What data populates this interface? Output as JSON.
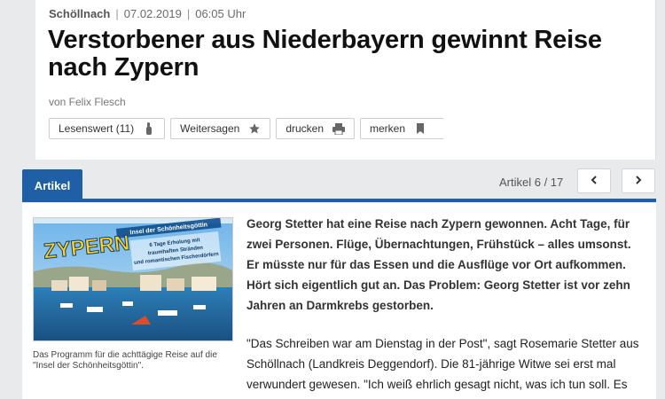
{
  "meta": {
    "location": "Schöllnach",
    "date": "07.02.2019",
    "time": "06:05 Uhr",
    "separator": "|"
  },
  "headline": "Verstorbener aus Niederbayern gewinnt Reise nach Zypern",
  "author": "von Felix Flesch",
  "actions": {
    "lesenswert": "Lesenswert (11)",
    "weitersagen": "Weitersagen",
    "drucken": "drucken",
    "merken": "merken"
  },
  "tabs": {
    "artikel": "Artikel",
    "counter": "Artikel 6 / 17"
  },
  "nav": {
    "prev_icon": "chevron-left-icon",
    "next_icon": "chevron-right-icon"
  },
  "figure": {
    "brochure_title": "ZYPERN",
    "brochure_subtitle": "Insel der Schönheitsgöttin",
    "brochure_line1": "6 Tage Erholung mit",
    "brochure_line2": "traumhaften Stränden",
    "brochure_line3": "und romantischen Fischerdörfern",
    "caption": "Das Programm für die achttägige Reise auf die \"Insel der Schönheitsgöttin\"."
  },
  "article": {
    "lead": "Georg Stetter hat eine Reise nach Zypern gewonnen. Acht Tage, für zwei Personen. Flüge, Übernachtungen, Frühstück – alles umsonst. Er müsste nur für das Essen und die Ausflüge vor Ort aufkommen. Hört sich eigentlich gut an. Das Problem: Georg Stetter ist vor zehn Jahren an Darmkrebs gestorben.",
    "para2": "\"Das Schreiben war am Dienstag in der Post\", sagt Rosemarie Stetter aus Schöllnach (Landkreis Deggendorf). Die 81-jährige Witwe sei erst mal verwundert gewesen. \"Ich weiß ehrlich gesagt nicht, was ich tun soll. Es"
  },
  "colors": {
    "accent": "#1f5fa6",
    "background": "#e9eaec"
  }
}
